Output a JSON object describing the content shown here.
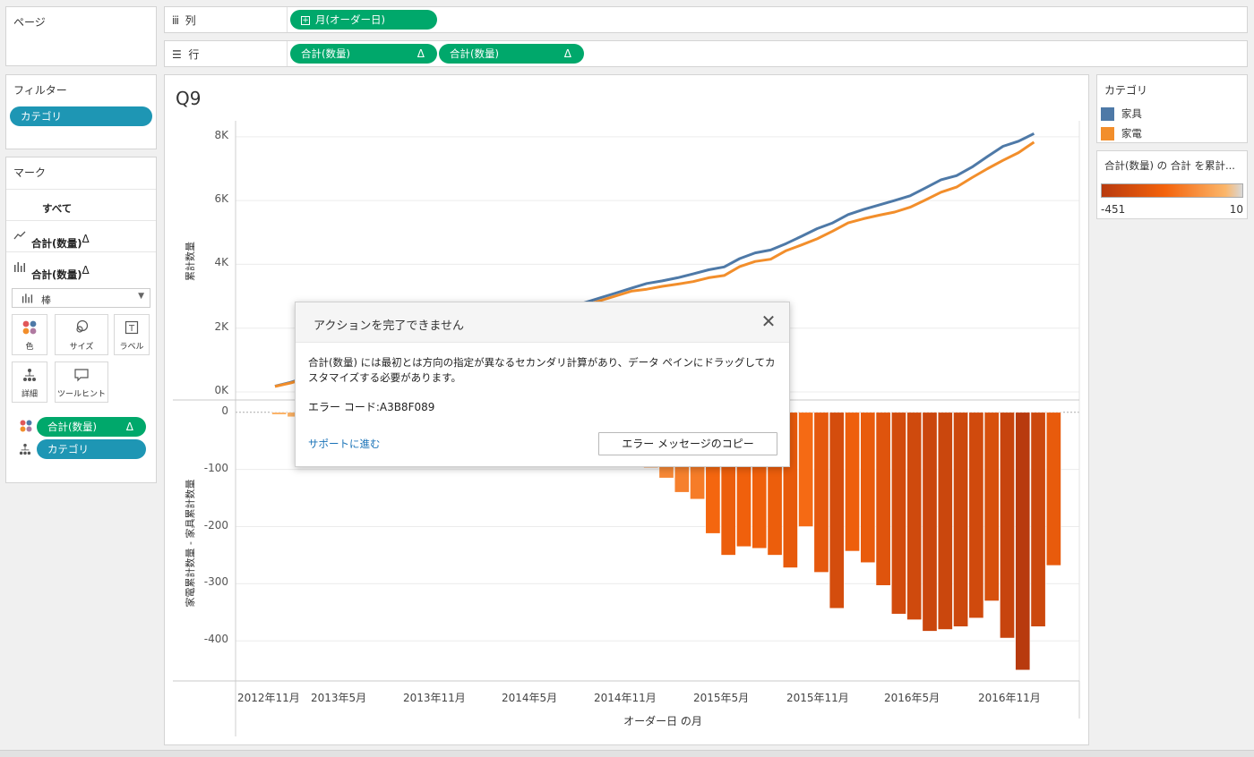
{
  "pages_shelf": {
    "title": "ページ"
  },
  "filters": {
    "title": "フィルター",
    "pills": [
      "カテゴリ"
    ]
  },
  "marks": {
    "title": "マーク",
    "all_label": "すべて",
    "cards": [
      {
        "label": "合計(数量)",
        "delta": "Δ",
        "icon": "line-chart-icon"
      },
      {
        "label": "合計(数量)",
        "delta": "Δ",
        "icon": "bar-chart-icon"
      }
    ],
    "type_select": "棒",
    "buttons": [
      {
        "label": "色",
        "icon": "color-icon"
      },
      {
        "label": "サイズ",
        "icon": "size-icon"
      },
      {
        "label": "ラベル",
        "icon": "label-icon"
      },
      {
        "label": "詳細",
        "icon": "detail-icon"
      },
      {
        "label": "ツールヒント",
        "icon": "tooltip-icon"
      }
    ],
    "field_pills": [
      {
        "label": "合計(数量)",
        "delta": "Δ",
        "color": "#00a86b",
        "icon": "color-icon"
      },
      {
        "label": "カテゴリ",
        "color": "#1e96b4",
        "icon": "detail-icon"
      }
    ]
  },
  "columns_shelf": {
    "label": "列",
    "pills": [
      {
        "label": "月(オーダー日)",
        "icon": "plus-box-icon"
      }
    ]
  },
  "rows_shelf": {
    "label": "行",
    "pills": [
      {
        "label": "合計(数量)",
        "delta": "Δ"
      },
      {
        "label": "合計(数量)",
        "delta": "Δ"
      }
    ]
  },
  "view": {
    "title": "Q9"
  },
  "legend_category": {
    "title": "カテゴリ",
    "items": [
      {
        "label": "家具",
        "color": "#4e79a7"
      },
      {
        "label": "家電",
        "color": "#f28e2b"
      }
    ]
  },
  "legend_color": {
    "title": "合計(数量) の 合計 を累計...",
    "min": "-451",
    "max": "10"
  },
  "chart_data": [
    {
      "type": "line",
      "ylabel": "累計数量",
      "y_ticks": [
        "8K",
        "6K",
        "4K",
        "2K",
        "0K"
      ],
      "ylim": [
        0,
        8500
      ],
      "grid": true,
      "series": [
        {
          "name": "家具",
          "color": "#4e79a7",
          "values": [
            180,
            300,
            450,
            600,
            720,
            850,
            990,
            1120,
            1250,
            1380,
            1500,
            1620,
            1760,
            1880,
            2000,
            2130,
            2260,
            2390,
            2520,
            2660,
            2800,
            2950,
            3100,
            3250,
            3400,
            3480,
            3580,
            3700,
            3830,
            3920,
            4180,
            4360,
            4450,
            4650,
            4880,
            5120,
            5300,
            5560,
            5720,
            5860,
            6000,
            6150,
            6400,
            6650,
            6780,
            7050,
            7380,
            7700,
            7860,
            8100
          ]
        },
        {
          "name": "家電",
          "color": "#f28e2b",
          "values": [
            170,
            280,
            420,
            560,
            680,
            800,
            930,
            1060,
            1190,
            1320,
            1440,
            1560,
            1690,
            1810,
            1930,
            2050,
            2180,
            2310,
            2440,
            2580,
            2710,
            2860,
            3010,
            3160,
            3220,
            3310,
            3380,
            3460,
            3580,
            3650,
            3930,
            4090,
            4160,
            4430,
            4610,
            4800,
            5040,
            5300,
            5430,
            5540,
            5640,
            5790,
            6020,
            6260,
            6420,
            6720,
            7000,
            7260,
            7500,
            7830
          ]
        }
      ]
    },
    {
      "type": "bar",
      "ylabel": "家電累計数量 - 家具累計数量",
      "y_ticks": [
        "0",
        "-100",
        "-200",
        "-300",
        "-400"
      ],
      "ylim": [
        -470,
        20
      ],
      "grid": true,
      "xlabel": "オーダー日 の月",
      "x_ticks": [
        "2012年11月",
        "2013年5月",
        "2013年11月",
        "2014年5月",
        "2014年11月",
        "2015年5月",
        "2015年11月",
        "2016年5月",
        "2016年11月"
      ],
      "color_scale": [
        "#b83a0e",
        "#f4630c",
        "#fbb66a"
      ],
      "color_range": [
        -451,
        10
      ],
      "values": [
        -4,
        -8,
        -10,
        -14,
        -18,
        -22,
        -24,
        -28,
        -30,
        -34,
        -38,
        -40,
        -44,
        -48,
        -50,
        -54,
        -58,
        -62,
        -66,
        -70,
        -74,
        -78,
        -84,
        -90,
        -97,
        -115,
        -140,
        -152,
        -212,
        -250,
        -235,
        -238,
        -250,
        -272,
        -200,
        -280,
        -343,
        -243,
        -263,
        -303,
        -353,
        -363,
        -383,
        -380,
        -375,
        -360,
        -330,
        -395,
        -451,
        -375,
        -268
      ]
    }
  ],
  "dialog": {
    "title": "アクションを完了できません",
    "message": "合計(数量) には最初とは方向の指定が異なるセカンダリ計算があり、データ ペインにドラッグしてカスタマイズする必要があります。",
    "error_code": "エラー コード:A3B8F089",
    "support_link": "サポートに進む",
    "copy_button": "エラー メッセージのコピー",
    "close_icon": "close-icon"
  }
}
